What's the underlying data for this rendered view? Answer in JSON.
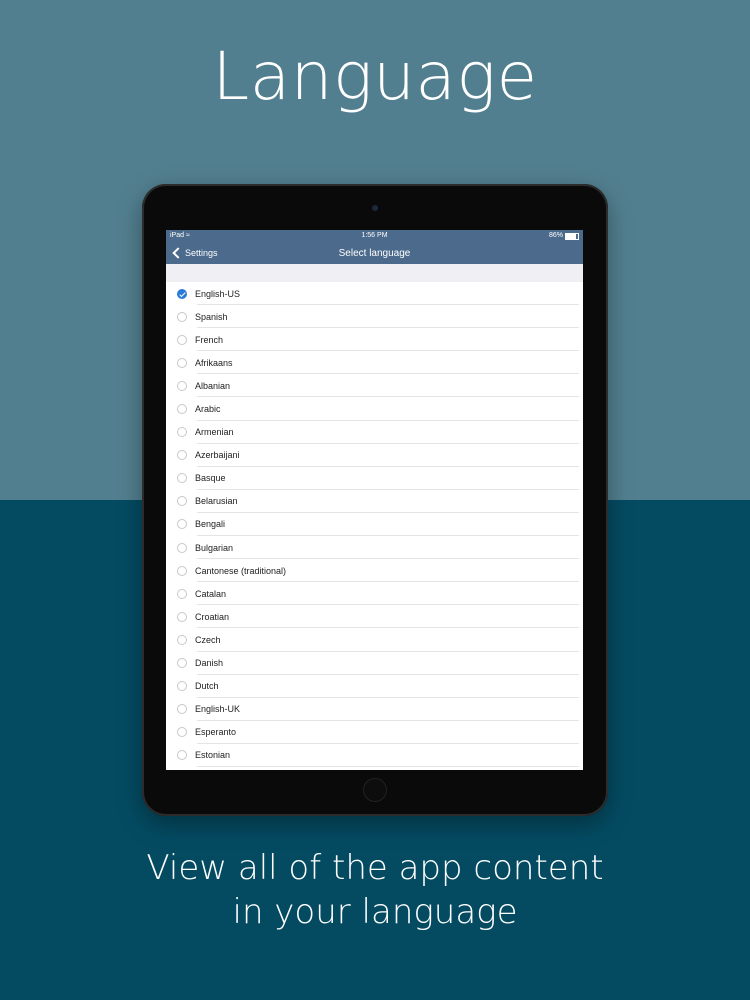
{
  "headline": "Language",
  "tagline": {
    "line1": "View all of the app content",
    "line2": "in your language"
  },
  "statusbar": {
    "carrier": "iPad",
    "time": "1:56 PM",
    "battery": "86%",
    "battery_level": 0.86
  },
  "navbar": {
    "back_label": "Settings",
    "title": "Select language"
  },
  "languages": [
    {
      "label": "English-US",
      "checked": true
    },
    {
      "label": "Spanish",
      "checked": false
    },
    {
      "label": "French",
      "checked": false
    },
    {
      "label": "Afrikaans",
      "checked": false
    },
    {
      "label": "Albanian",
      "checked": false
    },
    {
      "label": "Arabic",
      "checked": false
    },
    {
      "label": "Armenian",
      "checked": false
    },
    {
      "label": "Azerbaijani",
      "checked": false
    },
    {
      "label": "Basque",
      "checked": false
    },
    {
      "label": "Belarusian",
      "checked": false
    },
    {
      "label": "Bengali",
      "checked": false
    },
    {
      "label": "Bulgarian",
      "checked": false
    },
    {
      "label": "Cantonese (traditional)",
      "checked": false
    },
    {
      "label": "Catalan",
      "checked": false
    },
    {
      "label": "Croatian",
      "checked": false
    },
    {
      "label": "Czech",
      "checked": false
    },
    {
      "label": "Danish",
      "checked": false
    },
    {
      "label": "Dutch",
      "checked": false
    },
    {
      "label": "English-UK",
      "checked": false
    },
    {
      "label": "Esperanto",
      "checked": false
    },
    {
      "label": "Estonian",
      "checked": false
    }
  ]
}
